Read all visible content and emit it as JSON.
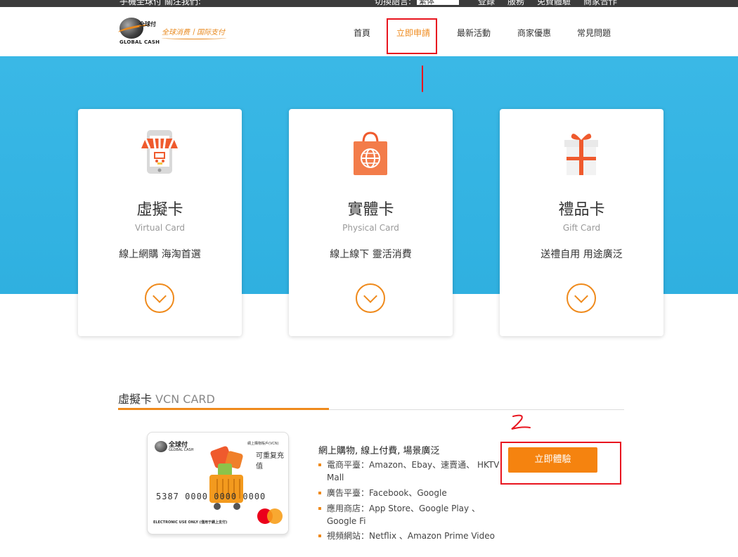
{
  "topbar": {
    "left_text": "手機全球付 關注我們:",
    "lang_label": "切換語言:",
    "lang_value": "繁体",
    "links": [
      "登錄",
      "服務",
      "免費體驗",
      "商家合作"
    ]
  },
  "header": {
    "logo_cn": "全球付",
    "logo_en": "GLOBAL CASH",
    "slogan": "全球消费丨国际支付",
    "nav": [
      "首頁",
      "立即申請",
      "最新活動",
      "商家優惠",
      "常見問題"
    ],
    "active_nav": "立即申請"
  },
  "cards": [
    {
      "title": "虛擬卡",
      "subtitle": "Virtual Card",
      "desc": "線上網購 海淘首選",
      "icon": "shop-phone-icon"
    },
    {
      "title": "實體卡",
      "subtitle": "Physical Card",
      "desc": "線上線下 靈活消費",
      "icon": "shopping-bag-icon"
    },
    {
      "title": "禮品卡",
      "subtitle": "Gift Card",
      "desc": "送禮自用 用途廣泛",
      "icon": "gift-icon"
    }
  ],
  "section": {
    "title_cn": "虛擬卡",
    "title_en": "VCN CARD"
  },
  "vcard": {
    "logo": "全球付",
    "logo_sub": "GLOBAL CASH",
    "type": "網上購物賬戶(VCN)",
    "recharge": "可重复充值",
    "number": "5387 0000 0000 0000",
    "footer": "ELECTRONIC USE ONLY (僅用于網上支付)"
  },
  "features": {
    "heading": "網上購物, 線上付費, 場景廣泛",
    "items": [
      "電商平臺：Amazon、Ebay、速賣通、 HKTV Mall",
      "廣告平臺：Facebook、Google",
      "應用商店：App Store、Google Play 、Google Fi",
      "視頻網站：Netflix 、Amazon Prime Video"
    ]
  },
  "cta": {
    "label": "立即體驗"
  },
  "colors": {
    "accent": "#ef8a1c",
    "banner": "#34b4e2",
    "annotation": "#e8151f"
  }
}
